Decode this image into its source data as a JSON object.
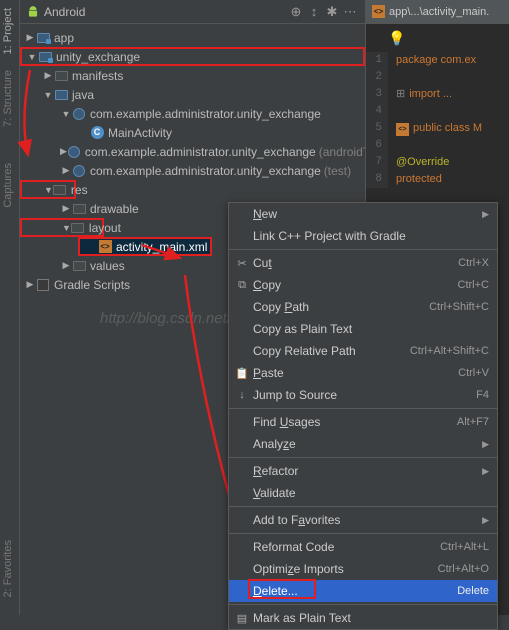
{
  "vertical_tabs": [
    "1: Project",
    "7: Structure",
    "Captures",
    "2: Favorites"
  ],
  "toolbar": {
    "title": "Android",
    "icons": [
      "target",
      "sort",
      "settings",
      "more"
    ]
  },
  "tree": {
    "app": "app",
    "unity_exchange": "unity_exchange",
    "manifests": "manifests",
    "java": "java",
    "pkg1": "com.example.administrator.unity_exchange",
    "main_activity": "MainActivity",
    "pkg2_prefix": "com.example.administrator.unity_exchange",
    "pkg2_suffix": "(androidTest)",
    "pkg3_prefix": "com.example.administrator.unity_exchange",
    "pkg3_suffix": "(test)",
    "res": "res",
    "drawable": "drawable",
    "layout": "layout",
    "activity_main": "activity_main.xml",
    "values": "values",
    "gradle_scripts": "Gradle Scripts"
  },
  "editor": {
    "tab": "app\\...\\activity_main.",
    "lines": {
      "1": "package com.ex",
      "2": "",
      "3": "import ...",
      "4": "",
      "5": "public class M",
      "6": "",
      "7": "    @Override",
      "8": "    protected"
    }
  },
  "menu": {
    "new": "New",
    "link_cpp": "Link C++ Project with Gradle",
    "cut": "Cut",
    "cut_s": "Ctrl+X",
    "copy": "Copy",
    "copy_s": "Ctrl+C",
    "copy_path": "Copy Path",
    "copy_path_s": "Ctrl+Shift+C",
    "copy_plain": "Copy as Plain Text",
    "copy_rel": "Copy Relative Path",
    "copy_rel_s": "Ctrl+Alt+Shift+C",
    "paste": "Paste",
    "paste_s": "Ctrl+V",
    "jump": "Jump to Source",
    "jump_s": "F4",
    "find_usages": "Find Usages",
    "find_usages_s": "Alt+F7",
    "analyze": "Analyze",
    "refactor": "Refactor",
    "validate": "Validate",
    "add_fav": "Add to Favorites",
    "reformat": "Reformat Code",
    "reformat_s": "Ctrl+Alt+L",
    "optimize": "Optimize Imports",
    "optimize_s": "Ctrl+Alt+O",
    "delete": "Delete...",
    "delete_s": "Delete",
    "mark_plain": "Mark as Plain Text"
  },
  "watermark": "http://blog.csdn.net/BuladeMian"
}
